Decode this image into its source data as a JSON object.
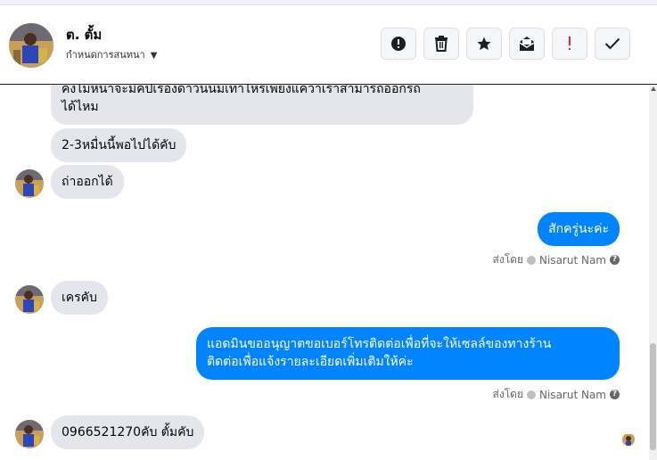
{
  "header": {
    "contact_name": "ต. ตั้ม",
    "status_label": "กำหนดการสนทนา",
    "actions": [
      {
        "icon": "alert-circle-icon",
        "color": "#1c1e21"
      },
      {
        "icon": "trash-icon",
        "color": "#1c1e21"
      },
      {
        "icon": "star-icon",
        "color": "#1c1e21"
      },
      {
        "icon": "mail-icon",
        "color": "#1c1e21"
      },
      {
        "icon": "spam-exclamation-icon",
        "color": "#e4262c"
      },
      {
        "icon": "check-icon",
        "color": "#1c1e21"
      }
    ]
  },
  "messages": [
    {
      "id": "m1",
      "direction": "in",
      "lines": [
        "คงไม่หนาจะมีคปเรองดาวนนมเทาไหรเพยงแควาเราสามารถออกรถ",
        "ได้ไหม"
      ]
    },
    {
      "id": "m2",
      "direction": "in",
      "text": "2-3หมื่นนี้พอไปได้คับ"
    },
    {
      "id": "m3",
      "direction": "in",
      "text": "ถ่าออกได้"
    },
    {
      "id": "m4",
      "direction": "out",
      "text": "สักครู่นะค่ะ"
    },
    {
      "id": "m5",
      "direction": "in",
      "text": "เครคับ"
    },
    {
      "id": "m6",
      "direction": "out",
      "lines": [
        "แอดมินขออนุญาตขอเบอร์โทรติดต่อเพื่อที่จะให้เซลล์ของทางร้าน",
        "ติดต่อเพื่อแจ้งรายละเอียดเพิ่มเติมให้ค่ะ"
      ]
    },
    {
      "id": "m7",
      "direction": "in",
      "text": "0966521270คับ ตั้มคับ"
    }
  ],
  "sent_by": {
    "prefix": "ส่งโดย",
    "name": "Nisarut Nam",
    "help": "?"
  },
  "colors": {
    "outgoing": "#0084ff",
    "incoming": "#e4e6eb",
    "accent_red": "#e4262c"
  }
}
